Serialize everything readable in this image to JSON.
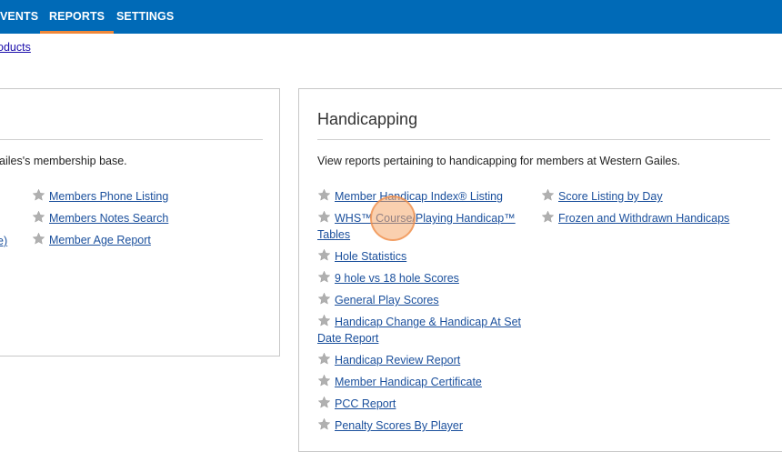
{
  "nav": {
    "events": "VENTS",
    "reports": "REPORTS",
    "settings": "SETTINGS"
  },
  "breadcrumb": {
    "label": "oducts"
  },
  "left_panel": {
    "description": "ailes's membership base.",
    "items": [
      {
        "label": "Members Phone Listing"
      },
      {
        "label": "Members Notes Search"
      },
      {
        "label": "Member Age Report"
      }
    ],
    "cut_link": "e)"
  },
  "right_panel": {
    "title": "Handicapping",
    "description": "View reports pertaining to handicapping for members at Western Gailes.",
    "col1": [
      {
        "label": "Member Handicap Index® Listing"
      },
      {
        "label": "WHS™ Course/Playing Handicap™",
        "label2": "Tables"
      },
      {
        "label": "Hole Statistics"
      },
      {
        "label": "9 hole vs 18 hole Scores"
      },
      {
        "label": "General Play Scores"
      },
      {
        "label": "Handicap Change & Handicap At Set",
        "label2": "Date Report"
      },
      {
        "label": "Handicap Review Report"
      },
      {
        "label": "Member Handicap Certificate"
      },
      {
        "label": "PCC Report"
      },
      {
        "label": "Penalty Scores By Player"
      }
    ],
    "col2": [
      {
        "label": "Score Listing by Day"
      },
      {
        "label": "Frozen and Withdrawn Handicaps"
      }
    ]
  },
  "colors": {
    "nav_bg": "#006ab7",
    "active_underline": "#f0883a",
    "link": "#1a4f9c",
    "star": "#b0b0b0"
  }
}
